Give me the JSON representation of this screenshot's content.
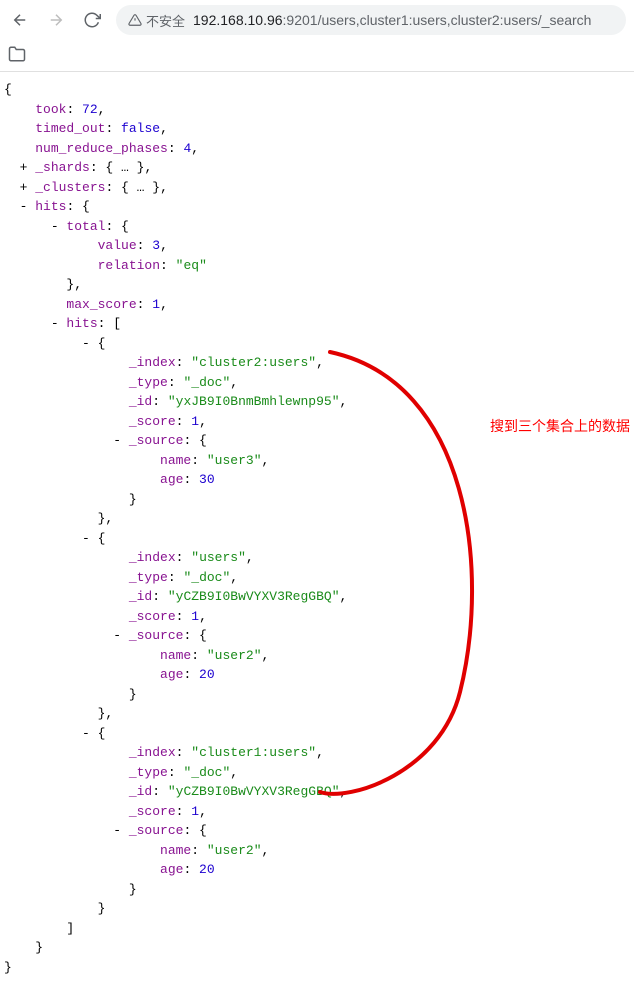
{
  "browser": {
    "insecure_label": "不安全",
    "url_prefix": "192.168.10.96",
    "url_suffix": ":9201/users,cluster1:users,cluster2:users/_search"
  },
  "annotation": {
    "text": "搜到三个集合上的数据"
  },
  "json": {
    "took": 72,
    "timed_out": "false",
    "num_reduce_phases": 4,
    "shards_label": "_shards",
    "clusters_label": "_clusters",
    "ellipsis": "…",
    "hits": {
      "total": {
        "value": 3,
        "relation": "eq"
      },
      "max_score": 1,
      "items": [
        {
          "_index": "cluster2:users",
          "_type": "_doc",
          "_id": "yxJB9I0BnmBmhlewnp95",
          "_score": 1,
          "name": "user3",
          "age": 30
        },
        {
          "_index": "users",
          "_type": "_doc",
          "_id": "yCZB9I0BwVYXV3RegGBQ",
          "_score": 1,
          "name": "user2",
          "age": 20
        },
        {
          "_index": "cluster1:users",
          "_type": "_doc",
          "_id": "yCZB9I0BwVYXV3RegGBQ",
          "_score": 1,
          "name": "user2",
          "age": 20
        }
      ]
    }
  }
}
